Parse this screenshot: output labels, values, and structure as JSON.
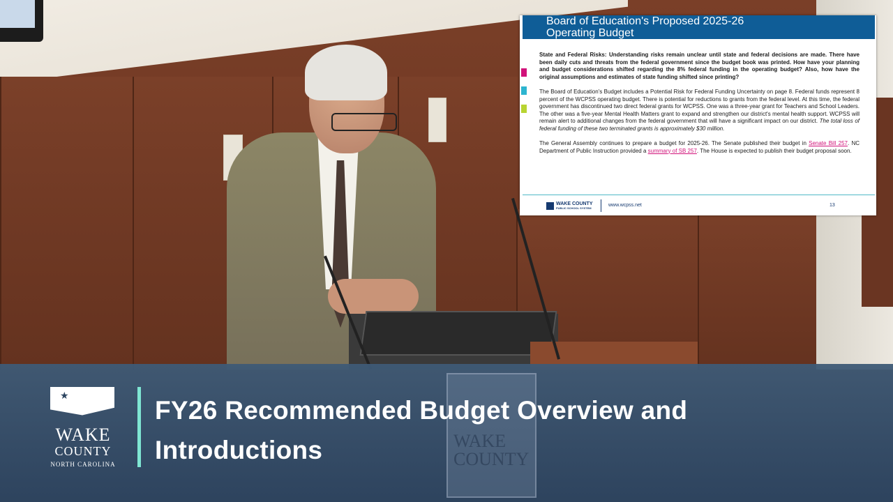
{
  "slide": {
    "header_line1": "Board of Education's Proposed 2025-26",
    "header_line2": "Operating Budget",
    "question": "State and Federal Risks: Understanding risks remain unclear until state and federal decisions are made. There have been daily cuts and threats from the federal government since the budget book was printed. How have your planning and budget considerations shifted regarding the 8% federal funding in the operating budget? Also, how have the original assumptions and estimates of state funding shifted since printing?",
    "para1_text": "The Board of Education's Budget includes a Potential Risk for Federal Funding Uncertainty on page 8.  Federal funds represent 8 percent of the WCPSS operating budget. There is potential for reductions to grants from the federal level. At this time, the federal government has discontinued two direct federal grants for WCPSS. One was a three-year grant for Teachers and School Leaders. The other was a five-year Mental Health Matters grant to expand and strengthen our district's mental health support. WCPSS will remain alert to additional changes from the federal government that will have a significant impact on our district. ",
    "para1_italic": "The total loss of federal funding of these two terminated grants is approximately $30 million.",
    "para2_a": "The General Assembly continues to prepare a budget for 2025-26.  The Senate published their budget in ",
    "para2_link1": "Senate Bill 257",
    "para2_b": ". NC Department of Public Instruction provided a ",
    "para2_link2": "summary of SB 257",
    "para2_c": ". The House is expected to publish their budget proposal soon.",
    "footer_logo": "WAKE COUNTY",
    "footer_logo_sub": "PUBLIC SCHOOL SYSTEM",
    "footer_url": "www.wcpss.net",
    "page_number": "13",
    "bar_colors": [
      "#d1127a",
      "#2db5d0",
      "#b8d432"
    ],
    "header_color": "#0f5d97"
  },
  "lower_third": {
    "title_line1": "FY26 Recommended Budget Overview and",
    "title_line2": "Introductions",
    "logo_wake": "WAKE",
    "logo_county": "COUNTY",
    "logo_state": "NORTH CAROLINA",
    "watermark_wake": "WAKE",
    "watermark_county": "COUNTY",
    "accent_color": "#7fe6d3"
  }
}
